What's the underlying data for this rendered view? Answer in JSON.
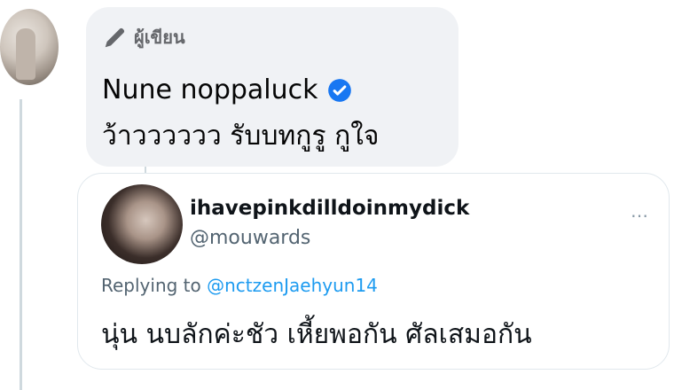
{
  "comment": {
    "author_badge_label": "ผู้เขียน",
    "author_name": "Nune noppaluck",
    "text": "ว้าวววววว รับบทกูรู กูใจ"
  },
  "quoted_tweet": {
    "display_name": "ihavepinkdilldoinmydick",
    "handle": "@mouwards",
    "replying_label": "Replying to",
    "replying_mention": "@nctzenJaehyun14",
    "text": "นุ่น นบลักค่ะชัว เหี้ยพอกัน ศัลเสมอกัน",
    "more_icon": "…"
  },
  "colors": {
    "bubble_bg": "#f0f2f5",
    "verified": "#1877f2",
    "link": "#1d9bf0",
    "muted": "#65676b"
  },
  "icons": [
    "pen-icon",
    "verified-badge-icon",
    "more-options-icon"
  ]
}
